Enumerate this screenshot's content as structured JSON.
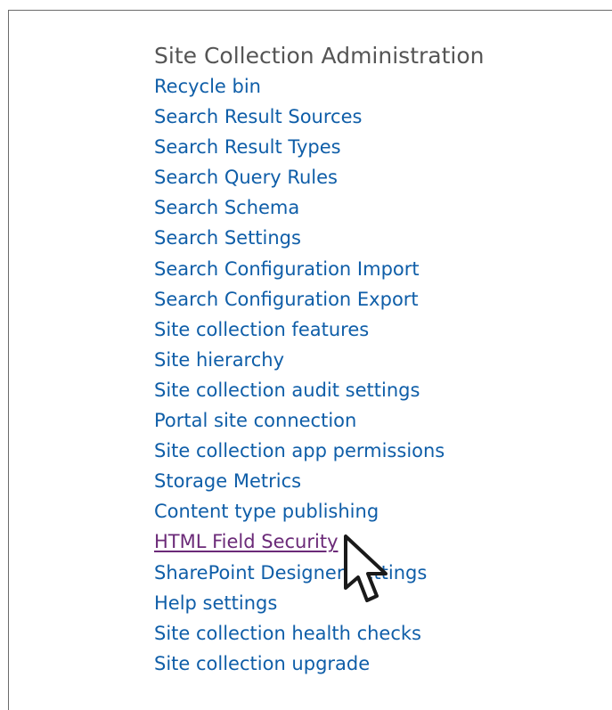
{
  "section": {
    "title": "Site Collection Administration",
    "links": [
      {
        "label": "Recycle bin",
        "hovered": false
      },
      {
        "label": "Search Result Sources",
        "hovered": false
      },
      {
        "label": "Search Result Types",
        "hovered": false
      },
      {
        "label": "Search Query Rules",
        "hovered": false
      },
      {
        "label": "Search Schema",
        "hovered": false
      },
      {
        "label": "Search Settings",
        "hovered": false
      },
      {
        "label": "Search Configuration Import",
        "hovered": false
      },
      {
        "label": "Search Configuration Export",
        "hovered": false
      },
      {
        "label": "Site collection features",
        "hovered": false
      },
      {
        "label": "Site hierarchy",
        "hovered": false
      },
      {
        "label": "Site collection audit settings",
        "hovered": false
      },
      {
        "label": "Portal site connection",
        "hovered": false
      },
      {
        "label": "Site collection app permissions",
        "hovered": false
      },
      {
        "label": "Storage Metrics",
        "hovered": false
      },
      {
        "label": "Content type publishing",
        "hovered": false
      },
      {
        "label": "HTML Field Security",
        "hovered": true
      },
      {
        "label": "SharePoint Designer Settings",
        "hovered": false
      },
      {
        "label": "Help settings",
        "hovered": false
      },
      {
        "label": "Site collection health checks",
        "hovered": false
      },
      {
        "label": "Site collection upgrade",
        "hovered": false
      }
    ]
  },
  "colors": {
    "link": "#0f5ea8",
    "link_hover": "#6b2a78",
    "title": "#555555"
  },
  "cursor": {
    "icon": "pointer-arrow-icon"
  }
}
